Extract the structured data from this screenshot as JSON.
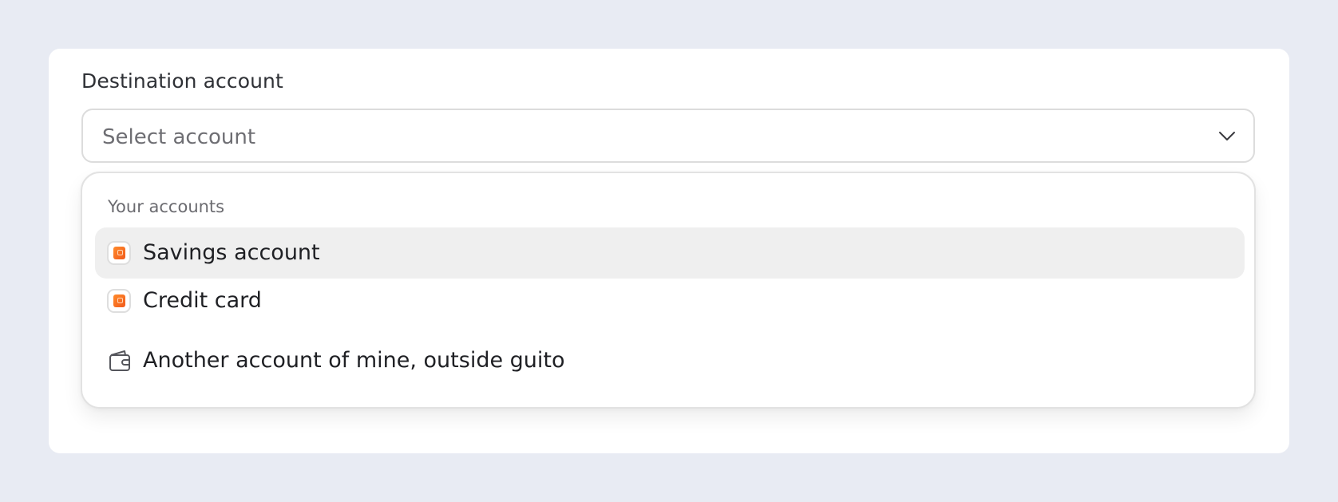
{
  "form": {
    "field_label": "Destination account",
    "select_placeholder": "Select account"
  },
  "dropdown": {
    "group_label": "Your accounts",
    "options": [
      {
        "label": "Savings account",
        "icon": "bank-account-icon",
        "highlighted": true
      },
      {
        "label": "Credit card",
        "icon": "bank-account-icon",
        "highlighted": false
      }
    ],
    "external_option": {
      "label": "Another account of mine, outside guito",
      "icon": "wallet-icon"
    }
  },
  "colors": {
    "background": "#e8ebf3",
    "accent": "#f15a1c",
    "highlight": "#efefef"
  }
}
